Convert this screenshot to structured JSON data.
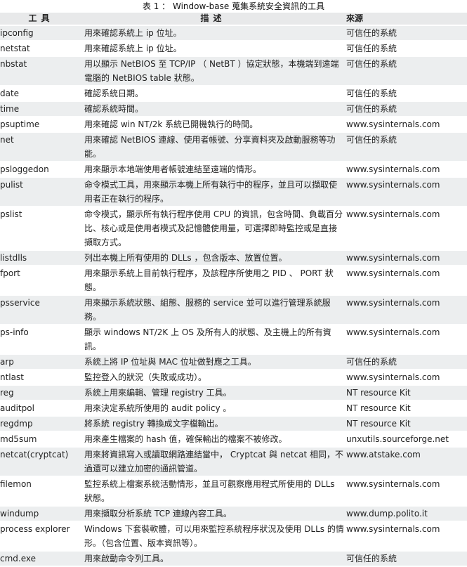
{
  "caption": "表 1 ： Window-base 蒐集系統安全資訊的工具",
  "headers": {
    "tool": "工具",
    "desc": "描述",
    "source": "來源"
  },
  "rows": [
    {
      "tool": "ipconfig",
      "desc": "用來確認系統上 ip 位址。",
      "source": "可信任的系統"
    },
    {
      "tool": "netstat",
      "desc": "用來確認系統上 ip 位址。",
      "source": "可信任的系統"
    },
    {
      "tool": "nbstat",
      "desc": "用以顯示 NetBIOS 至 TCP/IP （ NetBT ）協定狀態，本機端到遠端電腦的 NetBIOS table 狀態。",
      "source": "可信任的系統"
    },
    {
      "tool": "date",
      "desc": "確認系統日期。",
      "source": "可信任的系統"
    },
    {
      "tool": "time",
      "desc": "確認系統時間。",
      "source": "可信任的系統"
    },
    {
      "tool": "psuptime",
      "desc": "用來確認 win NT/2k 系統已開機執行的時間。",
      "source": "www.sysinternals.com"
    },
    {
      "tool": "net",
      "desc": "用來確認 NetBIOS 連線、使用者帳號、分享資料夾及啟動服務等功能。",
      "source": "可信任的系統"
    },
    {
      "tool": "psloggedon",
      "desc": "用來顯示本地端使用者帳號連結至遠端的情形。",
      "source": "www.sysinternals.com"
    },
    {
      "tool": "pulist",
      "desc": "命令模式工具，用來顯示本機上所有執行中的程序，並且可以擷取使用者正在執行的程序。",
      "source": "www.sysinternals.com"
    },
    {
      "tool": "pslist",
      "desc": "命令模式，顯示所有執行程序使用 CPU 的資訊，包含時間、負載百分比、核心或是使用者模式及記憶體使用量，可選擇即時監控或是直接擷取方式。",
      "source": "www.sysinternals.com"
    },
    {
      "tool": "listdlls",
      "desc": "列出本機上所有使用的 DLLs ，包含版本、放置位置。",
      "source": "www.sysinternals.com"
    },
    {
      "tool": "fport",
      "desc": "用來顯示系統上目前執行程序，及該程序所使用之 PID 、 PORT 狀態。",
      "source": "www.sysinternals.com"
    },
    {
      "tool": "psservice",
      "desc": "用來顯示系統狀態、組態、服務的 service 並可以進行管理系統服務。",
      "source": "www.sysinternals.com"
    },
    {
      "tool": "ps-info",
      "desc": "顯示 windows NT/2K 上 OS 及所有人的狀態、及主機上的所有資訊。",
      "source": "www.sysinternals.com"
    },
    {
      "tool": "arp",
      "desc": "系統上將 IP 位址與 MAC 位址做對應之工具。",
      "source": "可信任的系統"
    },
    {
      "tool": "ntlast",
      "desc": "監控登入的狀況（失敗或成功）。",
      "source": "www.sysinternals.com"
    },
    {
      "tool": "reg",
      "desc": "系統上用來編輯、管理 registry 工具。",
      "source": "NT resource Kit"
    },
    {
      "tool": "auditpol",
      "desc": "用來決定系統所使用的 audit policy 。",
      "source": "NT resource Kit"
    },
    {
      "tool": "regdmp",
      "desc": "將系統 registry 轉換成文字檔輸出。",
      "source": "NT resource Kit"
    },
    {
      "tool": "md5sum",
      "desc": "用來產生檔案的 hash 值，確保輸出的檔案不被修改。",
      "source": "unxutils.sourceforge.net"
    },
    {
      "tool": "netcat(cryptcat)",
      "desc": "用來將資訊寫入或讀取網路連結當中， Cryptcat 與 netcat 相同，不過還可以建立加密的通訊管道。",
      "source": "www.atstake.com"
    },
    {
      "tool": "filemon",
      "desc": "監控系統上檔案系統活動情形，並且可觀察應用程式所使用的 DLLs 狀態。",
      "source": "www.sysinternals.com"
    },
    {
      "tool": "windump",
      "desc": "用來擷取分析系統 TCP 連線內容工具。",
      "source": "www.dump.polito.it"
    },
    {
      "tool": "process explorer",
      "desc": "Windows 下套裝軟體，可以用來監控系統程序狀況及使用 DLLs 的情形。（包含位置、版本資訊等）。",
      "source": "www.sysinternals.com"
    },
    {
      "tool": "cmd.exe",
      "desc": "用來啟動命令列工具。",
      "source": "可信任的系統"
    }
  ]
}
